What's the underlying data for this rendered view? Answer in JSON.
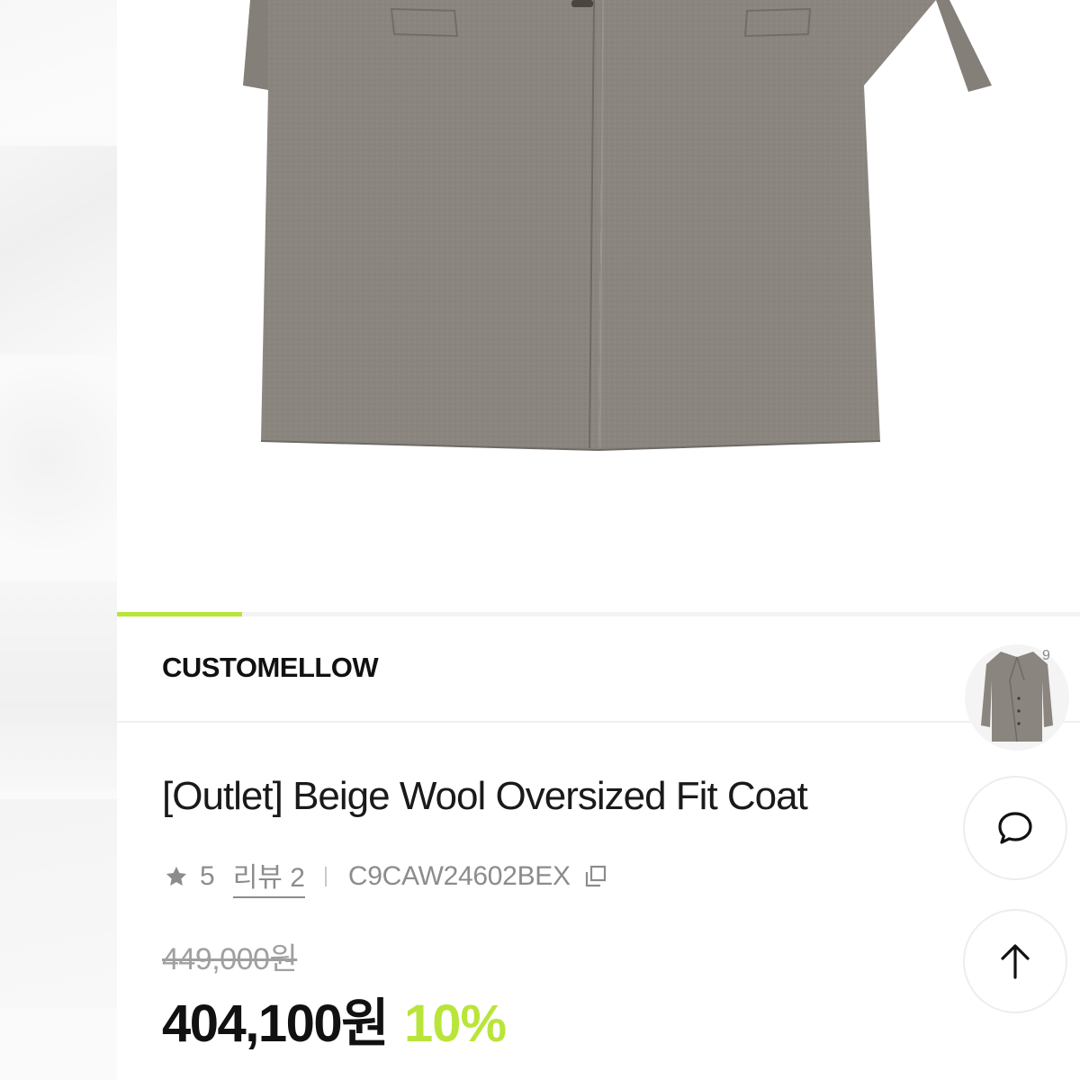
{
  "brand": "CUSTOMELLOW",
  "product": {
    "title": "[Outlet] Beige Wool Oversized Fit Coat",
    "rating": "5",
    "review_label": "리뷰 2",
    "sku": "C9CAW24602BEX",
    "original_price": "449,000원",
    "sale_price": "404,100원",
    "discount": "10%"
  },
  "gallery": {
    "progress": 0.13
  },
  "floating": {
    "badge": "9",
    "chat_icon": "chat-bubble-icon",
    "scroll_icon": "arrow-up-icon"
  },
  "colors": {
    "accent": "#b9e53a",
    "coat": "#8b857f",
    "muted_text": "#8c8c8c"
  }
}
